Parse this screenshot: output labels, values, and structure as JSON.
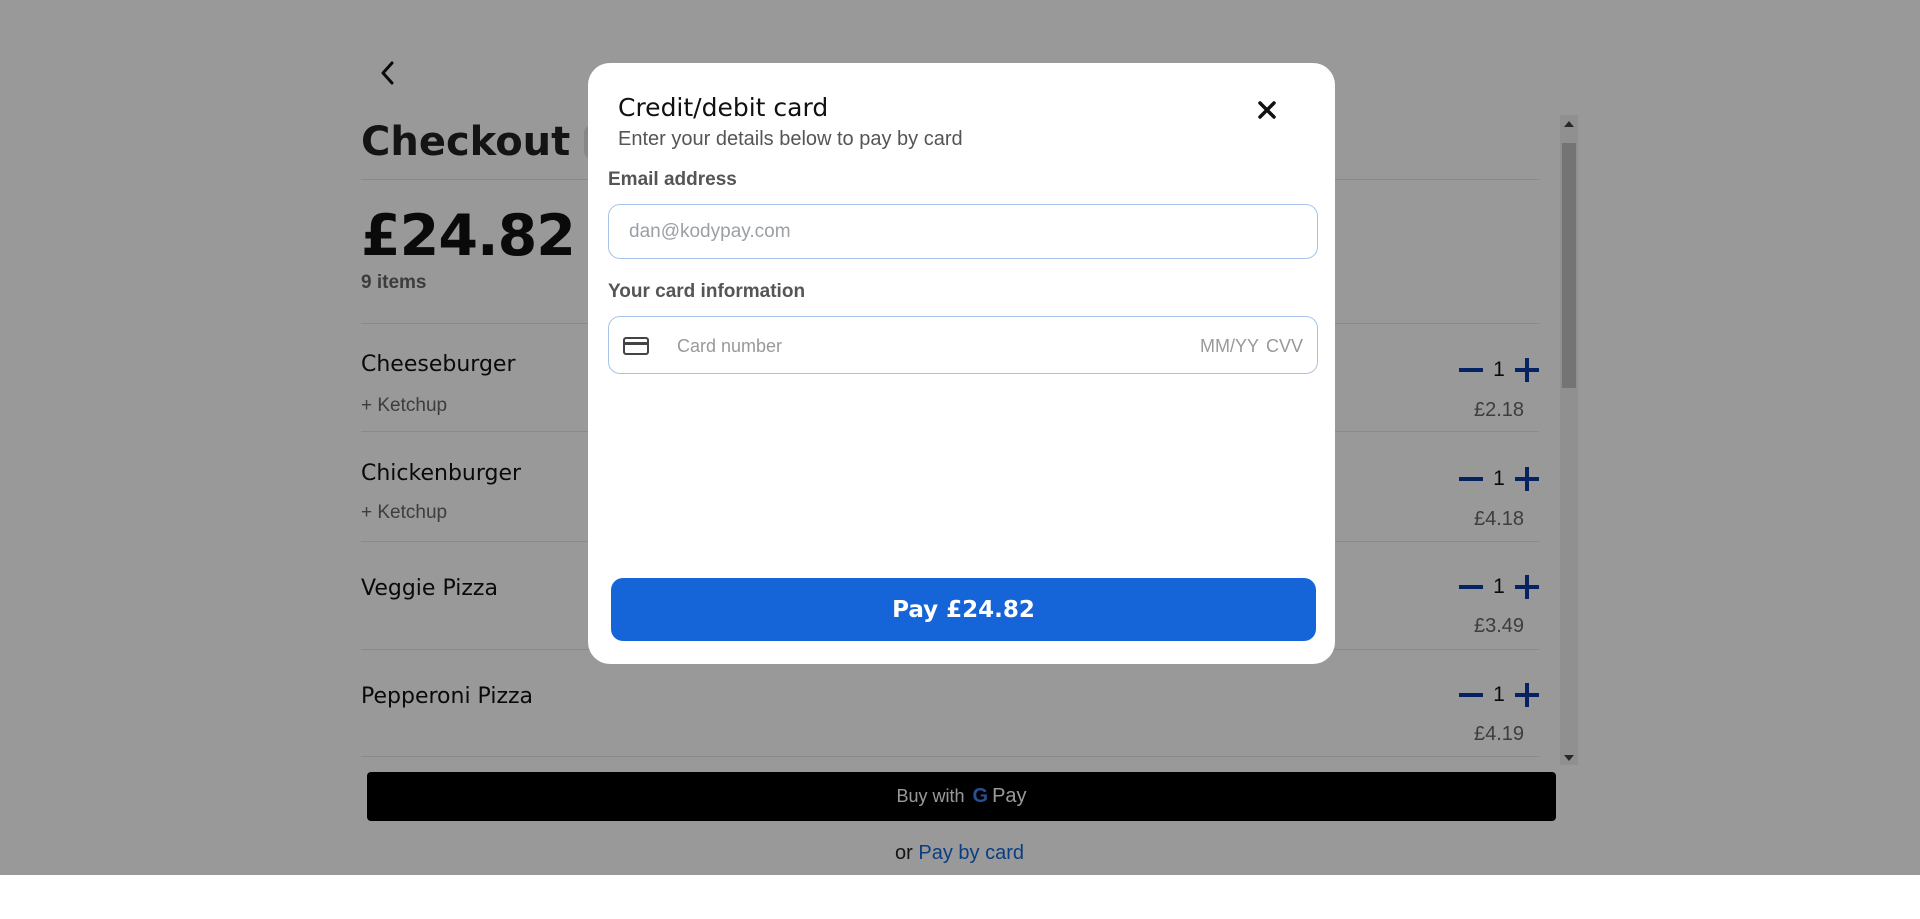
{
  "checkout": {
    "title": "Checkout",
    "total": "£24.82",
    "item_count": "9 items",
    "items": [
      {
        "name": "Cheeseburger",
        "modifier": "+ Ketchup",
        "qty": "1",
        "price": "£2.18"
      },
      {
        "name": "Chickenburger",
        "modifier": "+ Ketchup",
        "qty": "1",
        "price": "£4.18"
      },
      {
        "name": "Veggie Pizza",
        "modifier": "",
        "qty": "1",
        "price": "£3.49"
      },
      {
        "name": "Pepperoni Pizza",
        "modifier": "",
        "qty": "1",
        "price": "£4.19"
      }
    ],
    "gpay": {
      "prefix": "Buy with",
      "g": "G",
      "pay": "Pay"
    },
    "or_text": "or",
    "pay_by_card": "Pay by card"
  },
  "modal": {
    "title": "Credit/debit card",
    "subtitle": "Enter your details below to pay by card",
    "email_label": "Email address",
    "email_placeholder": "dan@kodypay.com",
    "card_label": "Your card information",
    "card_number_placeholder": "Card number",
    "expiry_placeholder": "MM/YY",
    "cvv_placeholder": "CVV",
    "pay_button": "Pay £24.82"
  },
  "colors": {
    "accent": "#1565d8",
    "qty_controls": "#0a3aa0",
    "overlay": "rgba(0,0,0,0.4)"
  },
  "icons": [
    "back-chevron-icon",
    "clock-icon",
    "close-icon",
    "card-icon",
    "minus-icon",
    "plus-icon"
  ]
}
